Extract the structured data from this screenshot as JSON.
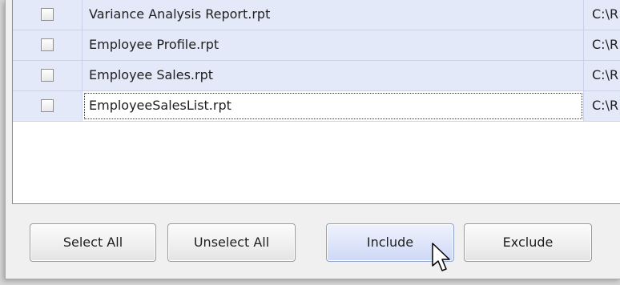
{
  "report_list": {
    "rows": [
      {
        "name": "Variance Analysis Report.rpt",
        "path": "C:\\R",
        "checked": false
      },
      {
        "name": "Employee Profile.rpt",
        "path": "C:\\R",
        "checked": false
      },
      {
        "name": "Employee Sales.rpt",
        "path": "C:\\R",
        "checked": false
      },
      {
        "name": "EmployeeSalesList.rpt",
        "path": "C:\\R",
        "checked": false,
        "focused": true
      }
    ]
  },
  "buttons": {
    "select_all": "Select All",
    "unselect_all": "Unselect All",
    "include": "Include",
    "exclude": "Exclude"
  },
  "colors": {
    "row_background": "#e4e9f9",
    "hover_button": "#dfe6fa"
  }
}
